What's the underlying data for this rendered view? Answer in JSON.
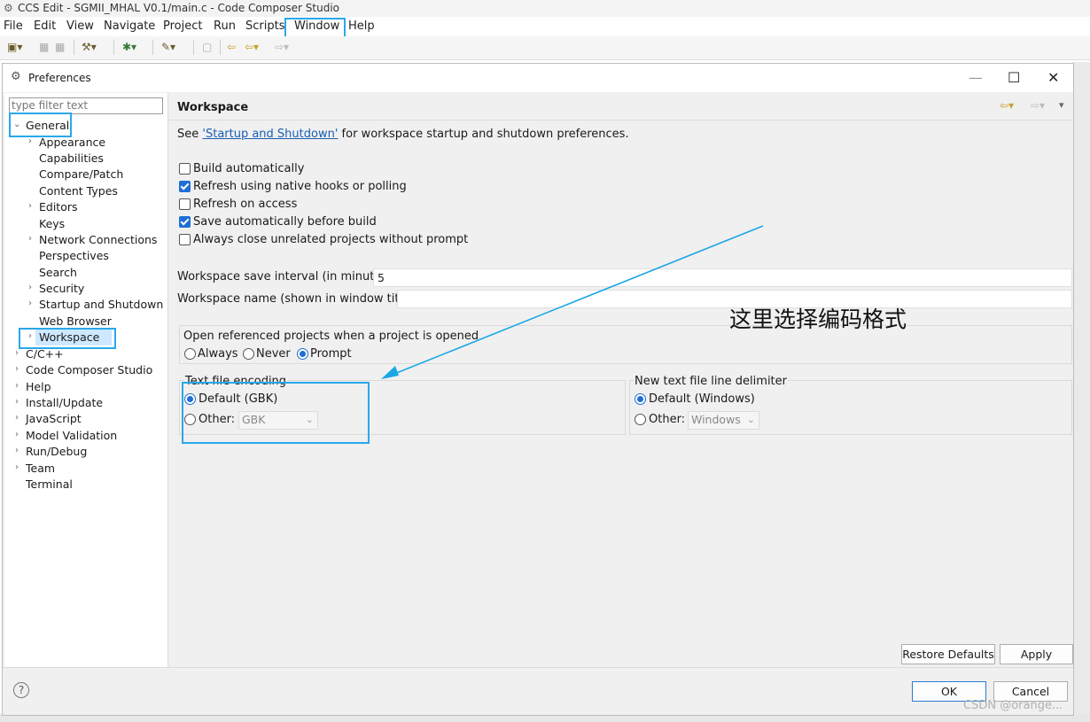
{
  "window": {
    "title": "CCS Edit - SGMII_MHAL V0.1/main.c - Code Composer Studio"
  },
  "menubar": [
    "File",
    "Edit",
    "View",
    "Navigate",
    "Project",
    "Run",
    "Scripts",
    "Window",
    "Help"
  ],
  "dialog": {
    "title": "Preferences",
    "filter_placeholder": "type filter text",
    "tree": [
      {
        "label": "General",
        "expanded": true,
        "level": 0
      },
      {
        "label": "Appearance",
        "level": 1,
        "expandable": true
      },
      {
        "label": "Capabilities",
        "level": 1
      },
      {
        "label": "Compare/Patch",
        "level": 1
      },
      {
        "label": "Content Types",
        "level": 1
      },
      {
        "label": "Editors",
        "level": 1,
        "expandable": true
      },
      {
        "label": "Keys",
        "level": 1
      },
      {
        "label": "Network Connections",
        "level": 1,
        "expandable": true
      },
      {
        "label": "Perspectives",
        "level": 1
      },
      {
        "label": "Search",
        "level": 1
      },
      {
        "label": "Security",
        "level": 1,
        "expandable": true
      },
      {
        "label": "Startup and Shutdown",
        "level": 1,
        "expandable": true
      },
      {
        "label": "Web Browser",
        "level": 1
      },
      {
        "label": "Workspace",
        "level": 1,
        "expandable": true,
        "selected": true
      },
      {
        "label": "C/C++",
        "level": 0,
        "expandable": true
      },
      {
        "label": "Code Composer Studio",
        "level": 0,
        "expandable": true
      },
      {
        "label": "Help",
        "level": 0,
        "expandable": true
      },
      {
        "label": "Install/Update",
        "level": 0,
        "expandable": true
      },
      {
        "label": "JavaScript",
        "level": 0,
        "expandable": true
      },
      {
        "label": "Model Validation",
        "level": 0,
        "expandable": true
      },
      {
        "label": "Run/Debug",
        "level": 0,
        "expandable": true
      },
      {
        "label": "Team",
        "level": 0,
        "expandable": true
      },
      {
        "label": "Terminal",
        "level": 0
      }
    ],
    "page": {
      "heading": "Workspace",
      "see_prefix": "See ",
      "see_link": "'Startup and Shutdown'",
      "see_suffix": " for workspace startup and shutdown preferences.",
      "checkboxes": [
        {
          "label": "Build automatically",
          "checked": false
        },
        {
          "label": "Refresh using native hooks or polling",
          "checked": true
        },
        {
          "label": "Refresh on access",
          "checked": false
        },
        {
          "label": "Save automatically before build",
          "checked": true
        },
        {
          "label": "Always close unrelated projects without prompt",
          "checked": false
        }
      ],
      "save_interval_label": "Workspace save interval (in minutes):",
      "save_interval_value": "5",
      "workspace_name_label": "Workspace name (shown in window title):",
      "workspace_name_value": "",
      "open_ref": {
        "label": "Open referenced projects when a project is opened",
        "options": [
          "Always",
          "Never",
          "Prompt"
        ],
        "selected": "Prompt"
      },
      "encoding": {
        "label": "Text file encoding",
        "default_label": "Default (GBK)",
        "other_label": "Other:",
        "other_value": "GBK",
        "selected": "default"
      },
      "delimiter": {
        "label": "New text file line delimiter",
        "default_label": "Default (Windows)",
        "other_label": "Other:",
        "other_value": "Windows",
        "selected": "default"
      },
      "restore_defaults": "Restore Defaults",
      "apply": "Apply"
    },
    "ok": "OK",
    "cancel": "Cancel"
  },
  "annotation": "这里选择编码格式",
  "watermark": "CSDN @orange...",
  "colors": {
    "highlight": "#2aa8ea",
    "accent": "#1e6fd6",
    "link": "#1a5fb4"
  }
}
